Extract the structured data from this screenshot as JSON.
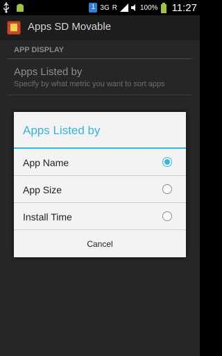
{
  "statusbar": {
    "badge": "1",
    "network": "3G",
    "roaming": "R",
    "battery_percent": "100%",
    "clock": "11:27"
  },
  "actionbar": {
    "title": "Apps SD Movable"
  },
  "preferences": {
    "category": "APP DISPLAY",
    "item_title": "Apps Listed by",
    "item_summary": "Specify by what metric you want to sort apps"
  },
  "dialog": {
    "title": "Apps Listed by",
    "options": [
      {
        "label": "App Name",
        "checked": true
      },
      {
        "label": "App Size",
        "checked": false
      },
      {
        "label": "Install Time",
        "checked": false
      }
    ],
    "cancel_label": "Cancel"
  },
  "colors": {
    "accent": "#33b5e5",
    "dialog_bg": "#f3f3f3",
    "actionbar_bg": "#1d1d1d"
  }
}
